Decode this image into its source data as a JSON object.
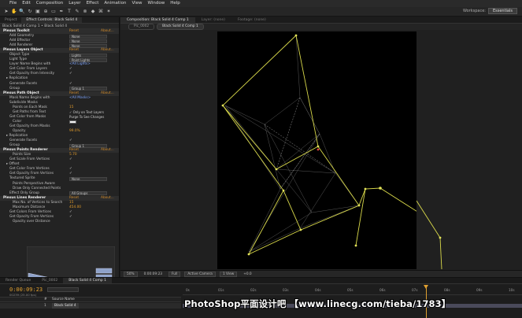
{
  "menubar": [
    "File",
    "Edit",
    "Composition",
    "Layer",
    "Effect",
    "Animation",
    "View",
    "Window",
    "Help"
  ],
  "toolbar": {
    "tools": [
      "arrow-tool",
      "hand-tool",
      "zoom-tool",
      "rotate-tool",
      "camera-tool",
      "pan-behind-tool",
      "rectangle-tool",
      "pen-tool",
      "type-tool",
      "brush-tool",
      "clone-tool",
      "eraser-tool",
      "roto-tool",
      "puppet-tool"
    ],
    "glyphs": [
      "➤",
      "✋",
      "🔍",
      "↻",
      "▣",
      "⊕",
      "▭",
      "✒",
      "T",
      "✎",
      "⊗",
      "◆",
      "⌘",
      "✶"
    ],
    "workspace_label": "Workspace:",
    "workspace_value": "Essentials"
  },
  "left_panel": {
    "tabs": [
      "Project",
      "Effect Controls: Black Solid 4"
    ],
    "breadcrumb": "Black Solid 4 Comp 1 • Black Solid 4",
    "reset": "Reset",
    "about": "About...",
    "rows": [
      {
        "type": "hdr",
        "label": "Plexus Toolkit"
      },
      {
        "type": "dd",
        "label": "Add Geometry",
        "value": "None",
        "indent": 1
      },
      {
        "type": "dd",
        "label": "Add Effector",
        "value": "None",
        "indent": 1
      },
      {
        "type": "dd",
        "label": "Add Renderer",
        "value": "None",
        "indent": 1
      },
      {
        "type": "hdr",
        "label": "Plexus Layers Object"
      },
      {
        "type": "dd",
        "label": "Object Type",
        "value": "Lights",
        "indent": 1
      },
      {
        "type": "dd",
        "label": "Light Type",
        "value": "Point Lights",
        "indent": 1
      },
      {
        "type": "val",
        "label": "Layer Name Begins with",
        "value": "<All Lights>",
        "color": "blue",
        "indent": 1
      },
      {
        "type": "chk",
        "label": "Get Color From Layers",
        "value": "✓",
        "indent": 1
      },
      {
        "type": "chk",
        "label": "Get Opacity from Intensity",
        "value": "✓",
        "indent": 1
      },
      {
        "type": "plain",
        "label": "▸ Replication",
        "indent": 0
      },
      {
        "type": "chk",
        "label": "Generate Facets",
        "value": "✓",
        "indent": 1
      },
      {
        "type": "dd",
        "label": "Group",
        "value": "Group 1",
        "indent": 1
      },
      {
        "type": "hdr",
        "label": "Plexus Path Object"
      },
      {
        "type": "val",
        "label": "Mask Name Begins with",
        "value": "<All Masks>",
        "color": "blue",
        "indent": 1
      },
      {
        "type": "plain",
        "label": "Subdivide Masks",
        "indent": 1
      },
      {
        "type": "val",
        "label": "Points on Each Mask",
        "value": "15",
        "color": "orange",
        "indent": 2
      },
      {
        "type": "chk2",
        "label": "Get Paths from Text",
        "value": "✓ Only on Text Layers",
        "indent": 2
      },
      {
        "type": "chk2",
        "label": "Get Color from Masks",
        "value": "Purge To See Changes",
        "indent": 1
      },
      {
        "type": "sw",
        "label": "Color",
        "indent": 2
      },
      {
        "type": "plain",
        "label": "Get Opacity from Masks",
        "indent": 1
      },
      {
        "type": "val",
        "label": "Opacity",
        "value": "99.0%",
        "color": "orange",
        "indent": 2
      },
      {
        "type": "plain",
        "label": "▸ Replication",
        "indent": 0
      },
      {
        "type": "chk",
        "label": "Generate Facets",
        "value": "✓",
        "indent": 1
      },
      {
        "type": "dd",
        "label": "Group",
        "value": "Group 1",
        "indent": 1
      },
      {
        "type": "hdr",
        "label": "Plexus Points Renderer"
      },
      {
        "type": "val",
        "label": "Points Size",
        "value": "5.70",
        "color": "orange",
        "indent": 2
      },
      {
        "type": "chk",
        "label": "Get Scale From Vertices",
        "value": "✓",
        "indent": 1
      },
      {
        "type": "plain",
        "label": "▸ Offset",
        "indent": 0
      },
      {
        "type": "chk",
        "label": "Get Color From Vertices",
        "value": "✓",
        "indent": 1
      },
      {
        "type": "chk",
        "label": "Get Opacity From Vertices",
        "value": "✓",
        "indent": 1
      },
      {
        "type": "dd",
        "label": "Textured Sprite",
        "value": "None",
        "indent": 1
      },
      {
        "type": "plain",
        "label": "Points Perspective Aware",
        "indent": 2
      },
      {
        "type": "plain",
        "label": "Draw Only Connected Points",
        "indent": 2
      },
      {
        "type": "dd",
        "label": "Effect Only Group",
        "value": "All Groups",
        "indent": 1
      },
      {
        "type": "hdr",
        "label": "Plexus Lines Renderer"
      },
      {
        "type": "val",
        "label": "Max No. of Vertices to Search",
        "value": "15",
        "color": "orange",
        "indent": 2
      },
      {
        "type": "val",
        "label": "Maximum Distance",
        "value": "454.00",
        "color": "orange",
        "indent": 2
      },
      {
        "type": "chk",
        "label": "Get Colors From Vertices",
        "value": "✓",
        "indent": 1
      },
      {
        "type": "chk",
        "label": "Get Opacity From Vertices",
        "value": "✓",
        "indent": 1
      },
      {
        "type": "plain",
        "label": "Opacity over Distance",
        "indent": 2
      }
    ]
  },
  "comp_panel": {
    "tabs": [
      "Composition: Black Solid 4 Comp 1",
      "Layer: (none)",
      "Footage: (none)"
    ],
    "subtabs": [
      "Pic_0002",
      "Black Solid 4 Comp 1"
    ],
    "bottom": [
      "50%",
      "0:00:09:23",
      "Full",
      "Active Camera",
      "1 View",
      "+0.0"
    ]
  },
  "timeline": {
    "tabs": [
      "Render Queue",
      "Pic_0002",
      "Black Solid 4 Comp 1"
    ],
    "timecode": "0:00:09:23",
    "timecode_sub": "00239 (25.00 fps)",
    "col_num": "#",
    "col_name": "Source Name",
    "layer_num": "1",
    "layer_name": "Black Solid 4",
    "ruler": [
      "0s",
      "01s",
      "02s",
      "03s",
      "04s",
      "05s",
      "06s",
      "07s",
      "08s",
      "09s",
      "10s"
    ]
  },
  "watermark": "PhotoShop平面设计吧 【www.linecg.com/tieba/1783】"
}
